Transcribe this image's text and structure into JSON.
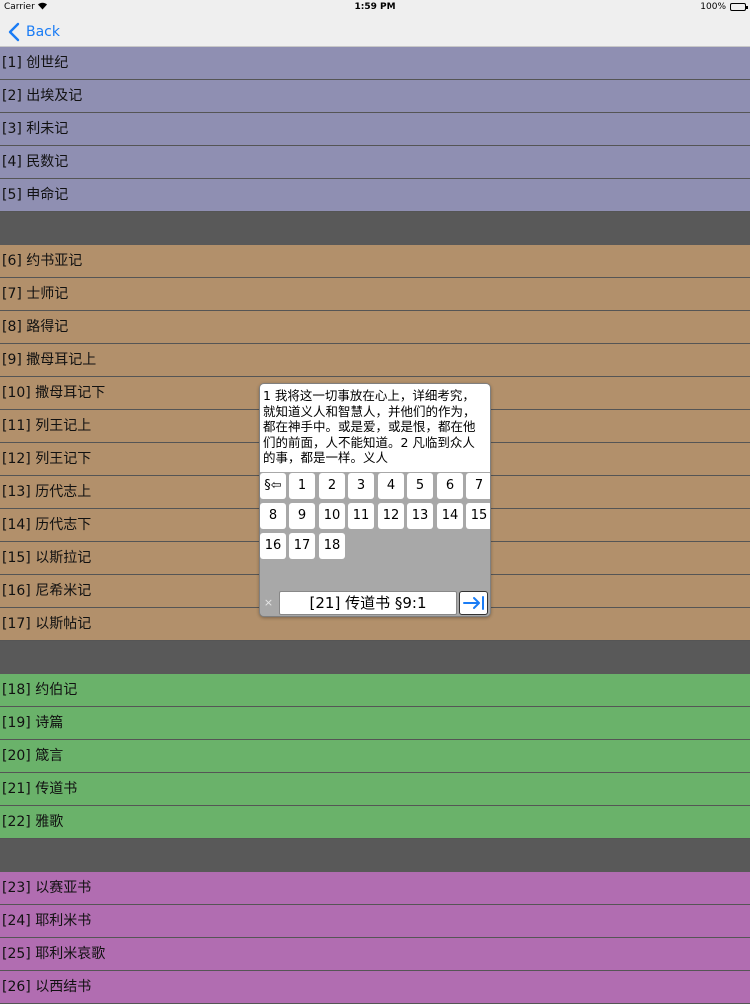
{
  "status_bar": {
    "carrier": "Carrier",
    "time": "1:59 PM",
    "battery": "100%",
    "battery_level": 1.0
  },
  "nav": {
    "back_label": "Back",
    "accent": "#1a7cf5"
  },
  "groups": [
    {
      "color": "#8f8fb2",
      "books": [
        "[1] 创世纪",
        "[2] 出埃及记",
        "[3] 利未记",
        "[4] 民数记",
        "[5] 申命记"
      ]
    },
    {
      "color": "#b2906b",
      "books": [
        "[6] 约书亚记",
        "[7] 士师记",
        "[8] 路得记",
        "[9] 撒母耳记上",
        "[10] 撒母耳记下",
        "[11] 列王记上",
        "[12] 列王记下",
        "[13] 历代志上",
        "[14] 历代志下",
        "[15] 以斯拉记",
        "[16] 尼希米记",
        "[17] 以斯帖记"
      ]
    },
    {
      "color": "#6ab26a",
      "books": [
        "[18] 约伯记",
        "[19] 诗篇",
        "[20] 箴言",
        "[21] 传道书",
        "[22] 雅歌"
      ]
    },
    {
      "color": "#b16db1",
      "books": [
        "[23] 以赛亚书",
        "[24] 耶利米书",
        "[25] 耶利米哀歌",
        "[26] 以西结书"
      ]
    }
  ],
  "popup": {
    "verse_text": "1 我将这一切事放在心上，详细考究，就知道义人和智慧人，并他们的作为，都在神手中。或是爱，或是恨，都在他们的前面，人不能知道。2 凡临到众人的事，都是一样。义人",
    "section_key": "§⇦",
    "keys": [
      "1",
      "2",
      "3",
      "4",
      "5",
      "6",
      "7",
      "8",
      "9",
      "10",
      "11",
      "12",
      "13",
      "14",
      "15",
      "16",
      "17",
      "18"
    ],
    "clear_icon": "×",
    "reference": "[21] 传道书 §9:1"
  }
}
